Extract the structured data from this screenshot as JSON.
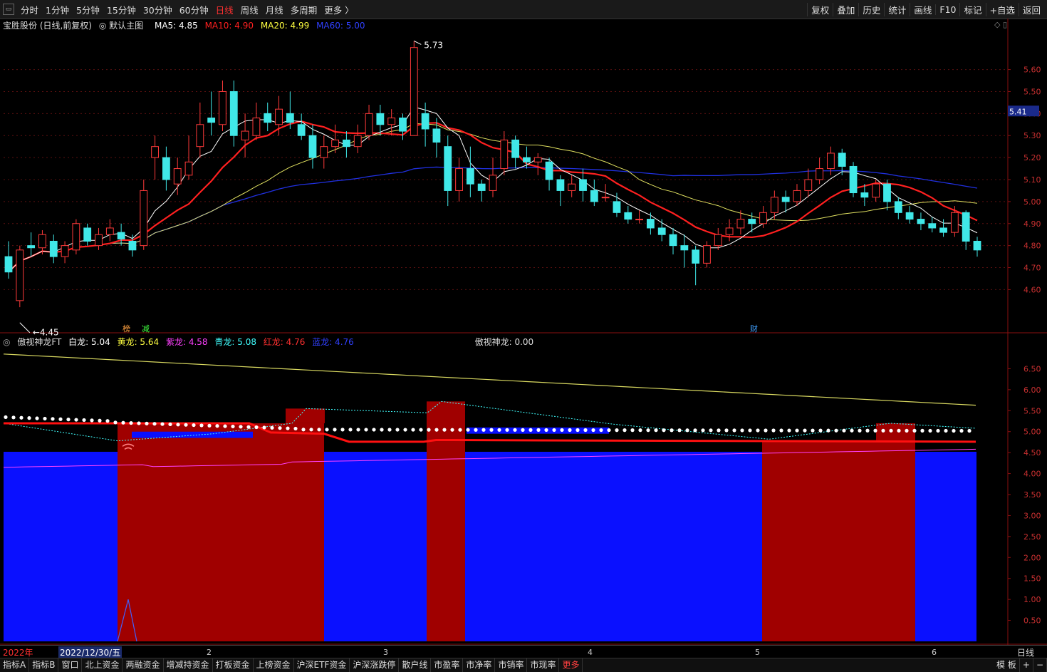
{
  "topbar": {
    "periods": [
      "分时",
      "1分钟",
      "5分钟",
      "15分钟",
      "30分钟",
      "60分钟",
      "日线",
      "周线",
      "月线",
      "多周期",
      "更多 〉"
    ],
    "active_period": "日线",
    "right_buttons": [
      "复权",
      "叠加",
      "历史",
      "统计",
      "画线",
      "F10",
      "标记",
      "+自选",
      "返回"
    ]
  },
  "main_header": {
    "stock": "宝胜股份 (日线,前复权)",
    "template": "默认主图",
    "ma5": "MA5: 4.85",
    "ma10": "MA10: 4.90",
    "ma20": "MA20: 4.99",
    "ma60": "MA60: 5.00",
    "colors": {
      "ma5": "#ffffff",
      "ma10": "#ff2020",
      "ma20": "#ffff40",
      "ma60": "#3040ff"
    }
  },
  "sub_header": {
    "name": "傲视神龙FT",
    "bai": "白龙: 5.04",
    "huang": "黄龙: 5.64",
    "zi": "紫龙: 4.58",
    "qing": "青龙: 5.08",
    "hong": "红龙: 4.76",
    "lan": "蓝龙: 4.76",
    "extra": "傲视神龙: 0.00"
  },
  "chart_data": [
    {
      "type": "candlestick",
      "title": "宝胜股份 (日线,前复权)",
      "y_ticks": [
        5.6,
        5.5,
        5.4,
        5.3,
        5.2,
        5.1,
        5.0,
        4.9,
        4.8,
        4.7,
        4.6
      ],
      "ylim": [
        4.42,
        5.78
      ],
      "last_price": "5.41",
      "high_label": "5.73",
      "low_label": "4.45",
      "markers": [
        "榜",
        "减",
        "财"
      ],
      "candles": [
        [
          4.75,
          4.68,
          4.82,
          4.65
        ],
        [
          4.55,
          4.78,
          4.8,
          4.52
        ],
        [
          4.8,
          4.79,
          4.86,
          4.75
        ],
        [
          4.79,
          4.85,
          4.87,
          4.76
        ],
        [
          4.82,
          4.75,
          4.85,
          4.72
        ],
        [
          4.75,
          4.8,
          4.82,
          4.72
        ],
        [
          4.78,
          4.9,
          4.92,
          4.76
        ],
        [
          4.88,
          4.82,
          4.9,
          4.8
        ],
        [
          4.8,
          4.85,
          4.88,
          4.78
        ],
        [
          4.85,
          4.88,
          4.92,
          4.82
        ],
        [
          4.86,
          4.83,
          4.9,
          4.8
        ],
        [
          4.82,
          4.78,
          4.85,
          4.75
        ],
        [
          4.8,
          5.05,
          5.1,
          4.78
        ],
        [
          5.2,
          5.25,
          5.3,
          5.1
        ],
        [
          5.2,
          5.1,
          5.25,
          5.05
        ],
        [
          5.08,
          5.15,
          5.2,
          5.03
        ],
        [
          5.12,
          5.18,
          5.3,
          5.1
        ],
        [
          5.25,
          5.35,
          5.45,
          5.2
        ],
        [
          5.38,
          5.36,
          5.5,
          5.3
        ],
        [
          5.35,
          5.5,
          5.55,
          5.32
        ],
        [
          5.5,
          5.3,
          5.55,
          5.25
        ],
        [
          5.28,
          5.32,
          5.4,
          5.2
        ],
        [
          5.3,
          5.38,
          5.45,
          5.28
        ],
        [
          5.4,
          5.36,
          5.45,
          5.32
        ],
        [
          5.35,
          5.42,
          5.48,
          5.3
        ],
        [
          5.4,
          5.36,
          5.5,
          5.33
        ],
        [
          5.35,
          5.3,
          5.4,
          5.28
        ],
        [
          5.3,
          5.2,
          5.35,
          5.15
        ],
        [
          5.2,
          5.25,
          5.3,
          5.15
        ],
        [
          5.25,
          5.28,
          5.35,
          5.22
        ],
        [
          5.28,
          5.25,
          5.32,
          5.2
        ],
        [
          5.25,
          5.3,
          5.35,
          5.22
        ],
        [
          5.3,
          5.4,
          5.44,
          5.28
        ],
        [
          5.4,
          5.35,
          5.44,
          5.3
        ],
        [
          5.35,
          5.38,
          5.42,
          5.3
        ],
        [
          5.38,
          5.32,
          5.4,
          5.28
        ],
        [
          5.3,
          5.7,
          5.73,
          5.3
        ],
        [
          5.4,
          5.33,
          5.45,
          5.25
        ],
        [
          5.33,
          5.27,
          5.38,
          5.2
        ],
        [
          5.25,
          5.05,
          5.3,
          4.98
        ],
        [
          5.05,
          5.15,
          5.2,
          5.0
        ],
        [
          5.15,
          5.08,
          5.25,
          5.02
        ],
        [
          5.08,
          5.05,
          5.1,
          5.0
        ],
        [
          5.05,
          5.12,
          5.2,
          5.02
        ],
        [
          5.15,
          5.28,
          5.32,
          5.12
        ],
        [
          5.28,
          5.2,
          5.3,
          5.15
        ],
        [
          5.2,
          5.18,
          5.25,
          5.15
        ],
        [
          5.18,
          5.2,
          5.22,
          5.12
        ],
        [
          5.18,
          5.1,
          5.2,
          5.05
        ],
        [
          5.1,
          5.05,
          5.12,
          4.98
        ],
        [
          5.05,
          5.08,
          5.12,
          5.02
        ],
        [
          5.1,
          5.05,
          5.15,
          5.0
        ],
        [
          5.05,
          5.0,
          5.1,
          4.98
        ],
        [
          5.02,
          5.02,
          5.08,
          5.0
        ],
        [
          5.0,
          4.95,
          5.04,
          4.93
        ],
        [
          4.95,
          4.92,
          4.98,
          4.9
        ],
        [
          4.92,
          4.92,
          4.96,
          4.9
        ],
        [
          4.92,
          4.88,
          4.95,
          4.85
        ],
        [
          4.88,
          4.85,
          4.92,
          4.82
        ],
        [
          4.85,
          4.8,
          4.88,
          4.76
        ],
        [
          4.8,
          4.78,
          4.85,
          4.7
        ],
        [
          4.78,
          4.72,
          4.8,
          4.62
        ],
        [
          4.72,
          4.8,
          4.82,
          4.7
        ],
        [
          4.8,
          4.85,
          4.88,
          4.78
        ],
        [
          4.85,
          4.88,
          4.92,
          4.82
        ],
        [
          4.88,
          4.92,
          4.96,
          4.85
        ],
        [
          4.92,
          4.9,
          4.95,
          4.86
        ],
        [
          4.9,
          4.95,
          4.98,
          4.88
        ],
        [
          4.95,
          5.02,
          5.05,
          4.92
        ],
        [
          5.02,
          5.0,
          5.05,
          4.95
        ],
        [
          5.0,
          5.05,
          5.08,
          4.98
        ],
        [
          5.05,
          5.1,
          5.15,
          5.02
        ],
        [
          5.1,
          5.15,
          5.2,
          5.08
        ],
        [
          5.15,
          5.22,
          5.25,
          5.12
        ],
        [
          5.22,
          5.16,
          5.24,
          5.12
        ],
        [
          5.16,
          5.04,
          5.18,
          5.02
        ],
        [
          5.04,
          5.02,
          5.08,
          4.98
        ],
        [
          5.02,
          5.08,
          5.1,
          5.0
        ],
        [
          5.08,
          5.0,
          5.1,
          4.96
        ],
        [
          5.0,
          4.95,
          5.02,
          4.92
        ],
        [
          4.95,
          4.92,
          4.98,
          4.9
        ],
        [
          4.92,
          4.9,
          4.95,
          4.87
        ],
        [
          4.9,
          4.88,
          4.93,
          4.86
        ],
        [
          4.88,
          4.86,
          4.92,
          4.84
        ],
        [
          4.86,
          4.95,
          4.98,
          4.84
        ],
        [
          4.95,
          4.82,
          4.96,
          4.78
        ],
        [
          4.82,
          4.78,
          4.84,
          4.75
        ]
      ]
    },
    {
      "type": "area",
      "title": "傲视神龙FT",
      "y_ticks": [
        6.5,
        6.0,
        5.5,
        5.0,
        4.5,
        4.0,
        3.5,
        3.0,
        2.5,
        2.0,
        1.5,
        1.0,
        0.5
      ],
      "ylim": [
        0,
        7.0
      ],
      "series": [
        {
          "name": "白龙",
          "value": 5.04
        },
        {
          "name": "黄龙",
          "value": 5.64
        },
        {
          "name": "紫龙",
          "value": 4.58
        },
        {
          "name": "青龙",
          "value": 5.08
        },
        {
          "name": "红龙",
          "value": 4.76
        },
        {
          "name": "蓝龙",
          "value": 4.76
        }
      ]
    }
  ],
  "date_axis": {
    "labels": [
      "2022年",
      "2022/12/30/五",
      "2",
      "3",
      "4",
      "5",
      "6"
    ],
    "period": "日线"
  },
  "bottom_tabs": [
    "指标A",
    "指标B",
    "窗口",
    "北上资金",
    "两融资金",
    "增减持资金",
    "打板资金",
    "上榜资金",
    "沪深ETF资金",
    "沪深涨跌停",
    "散户线",
    "市盈率",
    "市净率",
    "市销率",
    "市现率",
    "更多"
  ],
  "bottom_right": [
    "模 板",
    "+",
    "−"
  ]
}
